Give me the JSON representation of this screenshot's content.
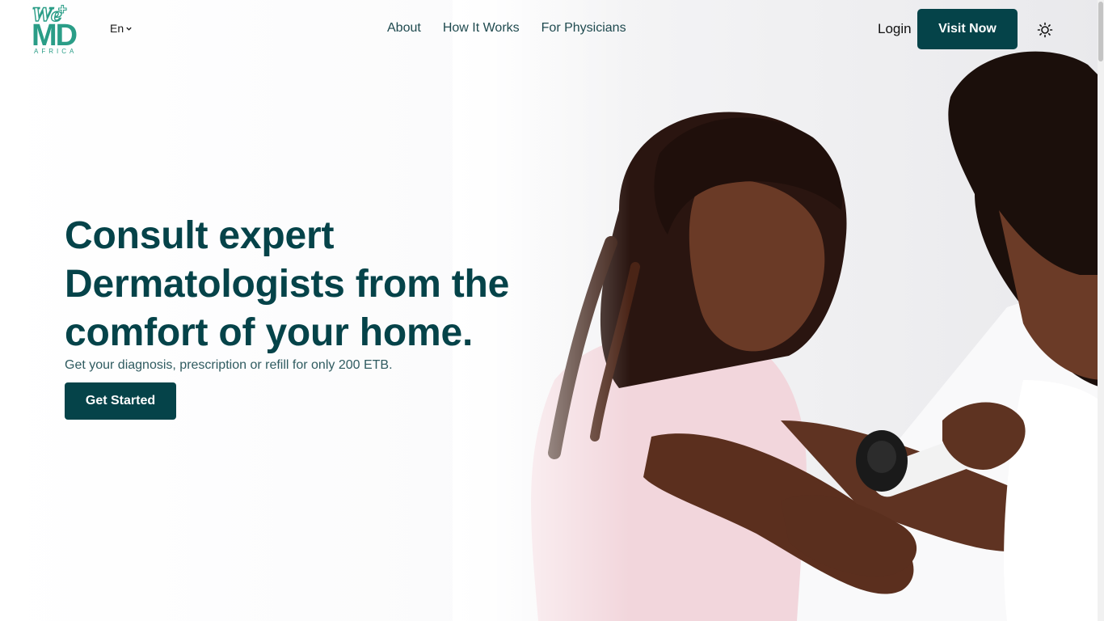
{
  "brand": {
    "logo_top": "We",
    "logo_main": "MD",
    "logo_sub": "AFRICA"
  },
  "header": {
    "language": "En",
    "nav": [
      {
        "label": "About"
      },
      {
        "label": "How It Works"
      },
      {
        "label": "For Physicians"
      }
    ],
    "login_label": "Login",
    "visit_label": "Visit Now"
  },
  "hero": {
    "headline": "Consult expert Dermatologists from the comfort of your home.",
    "subline": "Get your diagnosis, prescription or refill for only 200 ETB.",
    "cta_label": "Get Started"
  },
  "icons": {
    "language_chevron": "chevron-down-icon",
    "theme_toggle": "sun-icon"
  },
  "colors": {
    "primary": "#054349",
    "brand_teal": "#2a9d87",
    "nav_text": "#1f4a4f"
  }
}
